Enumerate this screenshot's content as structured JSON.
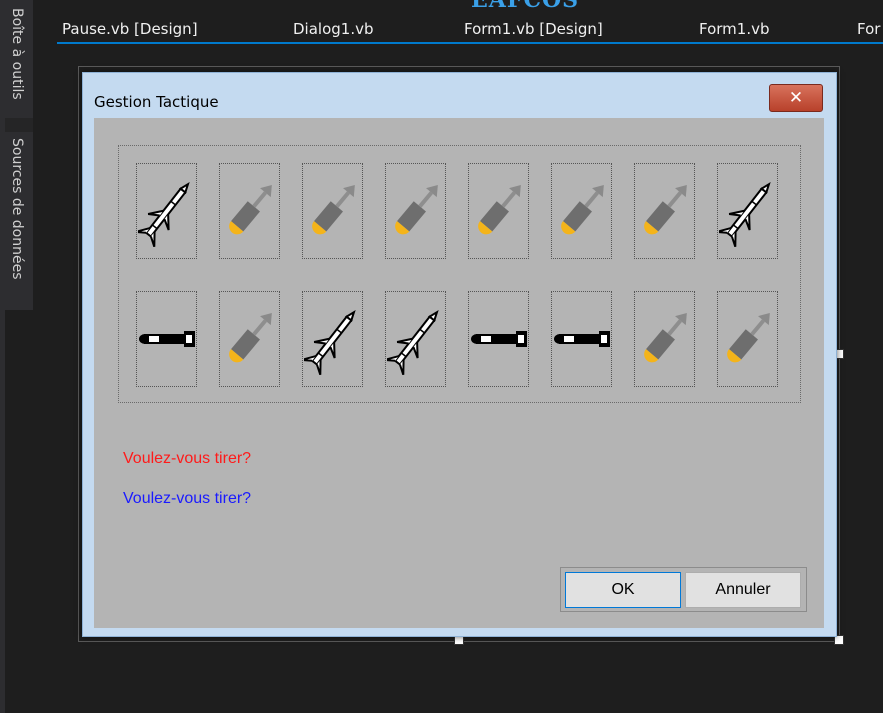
{
  "watermark": "EAFCOS",
  "toolbox": {
    "tabs": [
      "Boîte à outils",
      "Sources de données"
    ]
  },
  "editor_tabs": [
    {
      "label": "Pause.vb [Design]"
    },
    {
      "label": "Dialog1.vb"
    },
    {
      "label": "Form1.vb [Design]"
    },
    {
      "label": "Form1.vb"
    },
    {
      "label": "For"
    }
  ],
  "dialog": {
    "title": "Gestion Tactique",
    "close_label": "✕",
    "weapons_row1": [
      "missile",
      "bomb",
      "bomb",
      "bomb",
      "bomb",
      "bomb",
      "bomb",
      "missile"
    ],
    "weapons_row2": [
      "torpedo",
      "bomb",
      "missile",
      "missile",
      "torpedo",
      "torpedo",
      "bomb",
      "bomb"
    ],
    "message_red": "Voulez-vous tirer?",
    "message_blue": "Voulez-vous tirer?",
    "ok_label": "OK",
    "cancel_label": "Annuler",
    "colors": {
      "red": "#ff1a1a",
      "blue": "#1a1aff",
      "accent": "#007acc"
    }
  }
}
